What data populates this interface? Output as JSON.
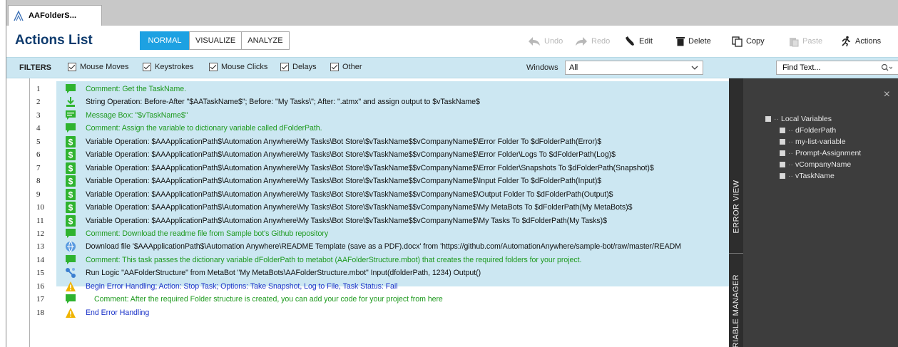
{
  "tab": {
    "title": "AAFolderS..."
  },
  "toolbar": {
    "title": "Actions List",
    "modes": [
      "NORMAL",
      "VISUALIZE",
      "ANALYZE"
    ],
    "undo": "Undo",
    "redo": "Redo",
    "edit": "Edit",
    "delete": "Delete",
    "copy": "Copy",
    "paste": "Paste",
    "actions": "Actions"
  },
  "filters": {
    "label": "FILTERS",
    "items": [
      "Mouse Moves",
      "Keystrokes",
      "Mouse Clicks",
      "Delays",
      "Other"
    ],
    "windows_label": "Windows",
    "windows_value": "All",
    "find_placeholder": "Find Text..."
  },
  "rows": [
    {
      "num": "1",
      "icon": "comment-icon",
      "text": "Comment: Get the TaskName."
    },
    {
      "num": "2",
      "icon": "string-operation-icon",
      "text": "String Operation: Before-After \"$AATaskName$\"; Before: \"My Tasks\\\"; After: \".atmx\" and assign output to $vTaskName$"
    },
    {
      "num": "3",
      "icon": "message-box-icon",
      "text": "Message Box: \"$vTaskName$\""
    },
    {
      "num": "4",
      "icon": "comment-icon",
      "text": "Comment: Assign the variable to dictionary variable called dFolderPath."
    },
    {
      "num": "5",
      "icon": "variable-operation-icon",
      "text": "Variable Operation: $AAApplicationPath$\\Automation Anywhere\\My Tasks\\Bot Store\\$vTaskName$$vCompanyName$\\Error Folder To $dFolderPath(Error)$"
    },
    {
      "num": "6",
      "icon": "variable-operation-icon",
      "text": "Variable Operation: $AAApplicationPath$\\Automation Anywhere\\My Tasks\\Bot Store\\$vTaskName$$vCompanyName$\\Error Folder\\Logs To $dFolderPath(Log)$"
    },
    {
      "num": "7",
      "icon": "variable-operation-icon",
      "text": "Variable Operation: $AAApplicationPath$\\Automation Anywhere\\My Tasks\\Bot Store\\$vTaskName$$vCompanyName$\\Error Folder\\Snapshots To $dFolderPath(Snapshot)$"
    },
    {
      "num": "8",
      "icon": "variable-operation-icon",
      "text": "Variable Operation: $AAApplicationPath$\\Automation Anywhere\\My Tasks\\Bot Store\\$vTaskName$$vCompanyName$\\Input Folder To $dFolderPath(Input)$"
    },
    {
      "num": "9",
      "icon": "variable-operation-icon",
      "text": "Variable Operation: $AAApplicationPath$\\Automation Anywhere\\My Tasks\\Bot Store\\$vTaskName$$vCompanyName$\\Output Folder To $dFolderPath(Output)$"
    },
    {
      "num": "10",
      "icon": "variable-operation-icon",
      "text": "Variable Operation: $AAApplicationPath$\\Automation Anywhere\\My Tasks\\Bot Store\\$vTaskName$$vCompanyName$\\My MetaBots To $dFolderPath(My MetaBots)$"
    },
    {
      "num": "11",
      "icon": "variable-operation-icon",
      "text": "Variable Operation: $AAApplicationPath$\\Automation Anywhere\\My Tasks\\Bot Store\\$vTaskName$$vCompanyName$\\My Tasks To $dFolderPath(My Tasks)$"
    },
    {
      "num": "12",
      "icon": "comment-icon",
      "text": "Comment: Download the readme file from Sample bot's Github repository"
    },
    {
      "num": "13",
      "icon": "download-file-icon",
      "text": "Download file '$AAApplicationPath$\\Automation Anywhere\\README Template (save as a PDF).docx' from 'https://github.com/AutomationAnywhere/sample-bot/raw/master/READM"
    },
    {
      "num": "14",
      "icon": "comment-icon",
      "text": "Comment: This task passes the dictionary variable dFolderPath to metabot (AAFolderStructure.mbot) that creates the required folders for your project."
    },
    {
      "num": "15",
      "icon": "run-logic-icon",
      "text": "Run Logic \"AAFolderStructure\" from MetaBot \"My MetaBots\\AAFolderStructure.mbot\" Input(dfolderPath, 1234) Output()"
    },
    {
      "num": "16",
      "icon": "warning-icon",
      "text": "Begin Error Handling; Action: Stop Task; Options: Take Snapshot, Log to File,  Task Status: Fail"
    },
    {
      "num": "17",
      "icon": "comment-icon",
      "text": "Comment: After the required Folder structure is created, you can add your code for your project from here"
    },
    {
      "num": "18",
      "icon": "warning-icon",
      "text": "End Error Handling"
    }
  ],
  "panel": {
    "tab_error_view": "ERROR VIEW",
    "tab_variable_manager": "VARIABLE MANAGER",
    "close": "×",
    "tree_root": "Local Variables",
    "variables": [
      "dFolderPath",
      "my-list-variable",
      "Prompt-Assignment",
      "vCompanyName",
      "vTaskName"
    ]
  },
  "colors": {
    "accent": "#1da1e2",
    "title": "#0e3b6e",
    "highlight": "#cce7f2",
    "comment": "#1f9a1f",
    "error": "#1a32c8",
    "panel": "#3d3d3d"
  }
}
